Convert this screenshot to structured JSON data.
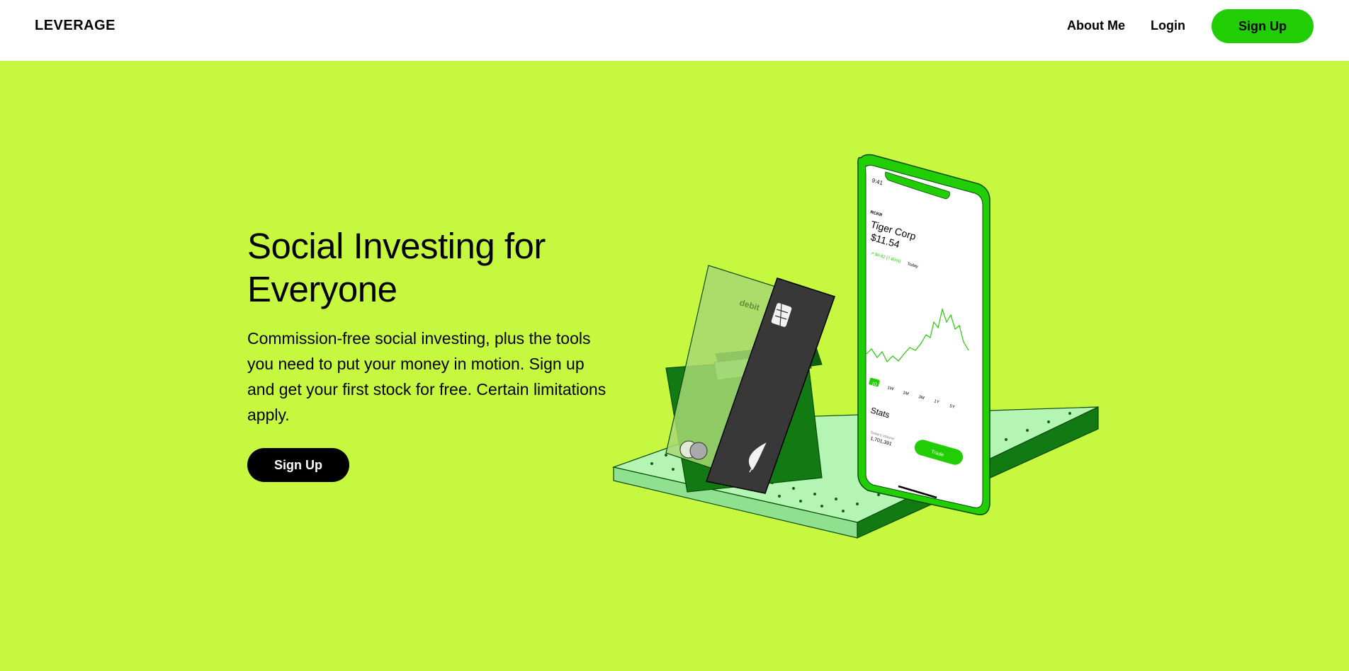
{
  "nav": {
    "logo": "LEVERAGE",
    "links": [
      "About Me",
      "Login"
    ],
    "signup_label": "Sign Up"
  },
  "hero": {
    "title": "Social Investing for Everyone",
    "description": "Commission-free social investing, plus the tools you need to put your money in motion. Sign up and get your first stock for free. Certain limitations apply.",
    "cta_label": "Sign Up"
  },
  "illustration": {
    "card_label": "debit",
    "phone": {
      "time": "9:41",
      "ticker": "RCKR",
      "company": "Tiger Corp",
      "price": "$11.54",
      "change": "↗ $0.82 (7.65%)",
      "change_period": "Today",
      "ranges": [
        "1D",
        "1W",
        "1M",
        "3M",
        "1Y",
        "5Y"
      ],
      "stats_label": "Stats",
      "volume_label": "Today's Volume",
      "volume_value": "1,701,391",
      "trade_label": "Trade"
    }
  },
  "colors": {
    "background": "#c6f83f",
    "brand_green": "#21ce04",
    "dark_green": "#127a12",
    "light_green": "#b4f5b4",
    "nav_bg": "#ffffff"
  }
}
